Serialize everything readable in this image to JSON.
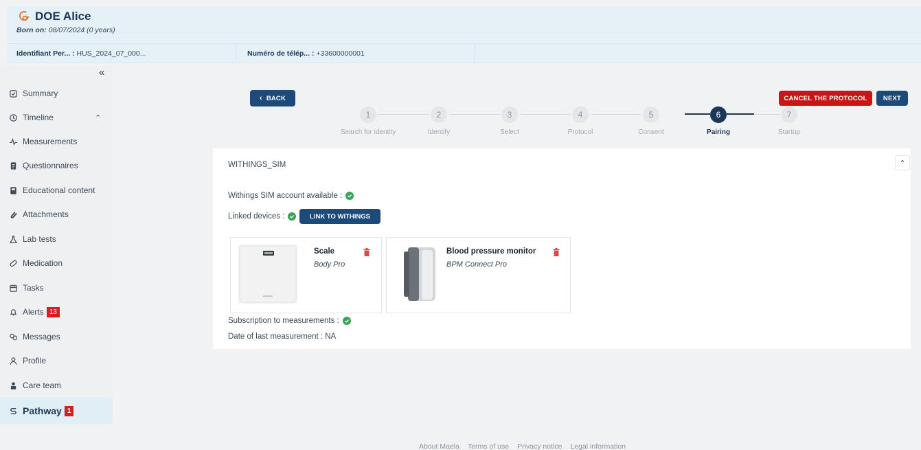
{
  "patient": {
    "name": "DOE Alice",
    "born_label": "Born on:",
    "born_value": "08/07/2024 (0 years)",
    "id_label": "Identifiant Per... :",
    "id_value": "HUS_2024_07_000...",
    "phone_label": "Numéro de télép... :",
    "phone_value": "+33600000001"
  },
  "sidebar": {
    "collapse": "«",
    "items": [
      {
        "label": "Summary",
        "icon": "summary-icon"
      },
      {
        "label": "Timeline",
        "icon": "clock-icon"
      },
      {
        "label": "Measurements",
        "icon": "pulse-icon"
      },
      {
        "label": "Questionnaires",
        "icon": "document-icon"
      },
      {
        "label": "Educational content",
        "icon": "book-icon"
      },
      {
        "label": "Attachments",
        "icon": "paperclip-icon"
      },
      {
        "label": "Lab tests",
        "icon": "lab-icon"
      },
      {
        "label": "Medication",
        "icon": "pill-icon"
      },
      {
        "label": "Tasks",
        "icon": "calendar-icon"
      },
      {
        "label": "Alerts",
        "icon": "bell-icon",
        "badge": "13"
      },
      {
        "label": "Messages",
        "icon": "messages-icon"
      },
      {
        "label": "Profile",
        "icon": "user-icon"
      },
      {
        "label": "Care team",
        "icon": "team-icon"
      },
      {
        "label": "Pathway",
        "icon": "pathway-icon",
        "badge": "1"
      }
    ]
  },
  "toolbar": {
    "back_label": "BACK",
    "cancel_label": "CANCEL THE PROTOCOL",
    "next_label": "NEXT"
  },
  "steps": [
    {
      "num": "1",
      "label": "Search for identity"
    },
    {
      "num": "2",
      "label": "Identify"
    },
    {
      "num": "3",
      "label": "Select"
    },
    {
      "num": "4",
      "label": "Protocol"
    },
    {
      "num": "5",
      "label": "Consent"
    },
    {
      "num": "6",
      "label": "Pairing"
    },
    {
      "num": "7",
      "label": "Startup"
    }
  ],
  "active_step": 6,
  "card": {
    "title": "WITHINGS_SIM",
    "account_label": "Withings SIM account available :",
    "linked_label": "Linked devices :",
    "link_button": "LINK TO WITHINGS",
    "subscription_label": "Subscription to measurements :",
    "last_measure_label": "Date of last measurement : NA",
    "devices": [
      {
        "name": "Scale",
        "model": "Body Pro"
      },
      {
        "name": "Blood pressure monitor",
        "model": "BPM Connect Pro"
      }
    ]
  },
  "footer": {
    "links": [
      "About Maela",
      "Terms of use",
      "Privacy notice",
      "Legal information"
    ]
  },
  "colors": {
    "primary": "#1c4a7a",
    "danger": "#cc1414",
    "success": "#3aa35a",
    "header_bg": "#e6f1f7"
  }
}
